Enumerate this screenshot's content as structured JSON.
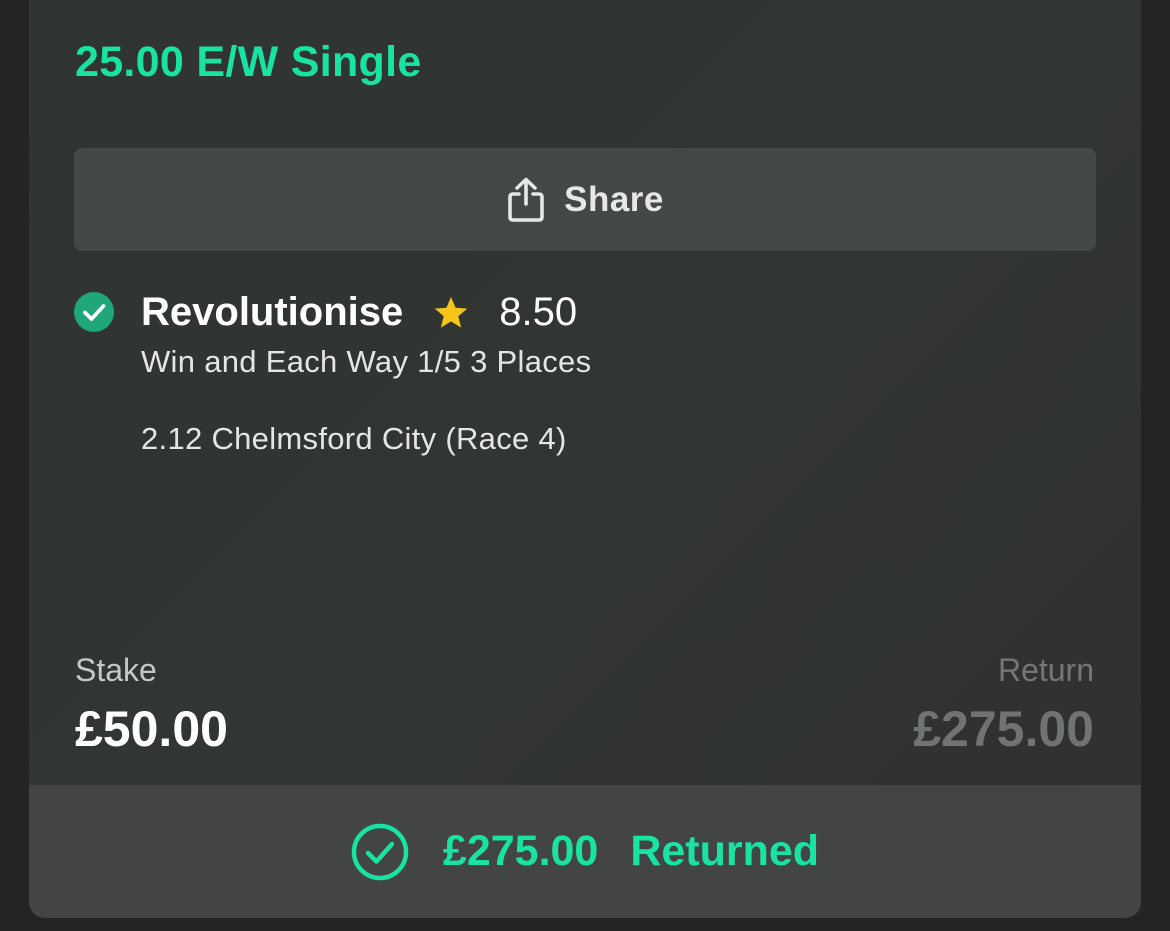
{
  "bet": {
    "title": "25.00 E/W Single"
  },
  "share": {
    "label": "Share",
    "icon": "share-icon"
  },
  "selection": {
    "status_icon": "check-circle-icon",
    "runner": "Revolutionise",
    "favourite_icon": "star-icon",
    "odds": "8.50",
    "market": "Win and Each Way 1/5 3 Places",
    "event": "2.12 Chelmsford City (Race 4)"
  },
  "stake": {
    "label": "Stake",
    "value": "£50.00"
  },
  "return": {
    "label": "Return",
    "value": "£275.00"
  },
  "result": {
    "icon": "check-circle-outline-icon",
    "amount": "£275.00",
    "label": "Returned"
  },
  "colors": {
    "accent": "#19e3a3",
    "star": "#f5c518",
    "card_background": "#313533",
    "page_background": "#242424"
  }
}
